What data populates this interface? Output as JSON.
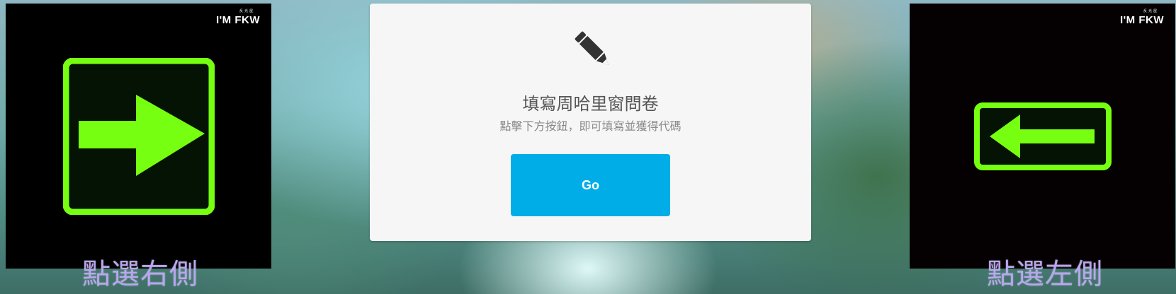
{
  "left_panel": {
    "brand": "I'M FKW",
    "brand_sub": "反光屋",
    "sign_icon": "right-arrow-sign-icon",
    "caption": "點選右側"
  },
  "survey_card": {
    "icon": "pencil-icon",
    "title": "填寫周哈里窗問卷",
    "subtitle": "點擊下方按鈕，即可填寫並獲得代碼",
    "button_label": "Go"
  },
  "right_panel": {
    "brand": "I'M FKW",
    "brand_sub": "反光屋",
    "sign_icon": "left-arrow-sign-icon",
    "caption": "點選左側"
  },
  "colors": {
    "sign_green": "#76ff10",
    "sign_dark": "#041304",
    "button_blue": "#00ade7",
    "card_bg": "#f6f6f6",
    "caption_purple": "#b9a6ef"
  }
}
